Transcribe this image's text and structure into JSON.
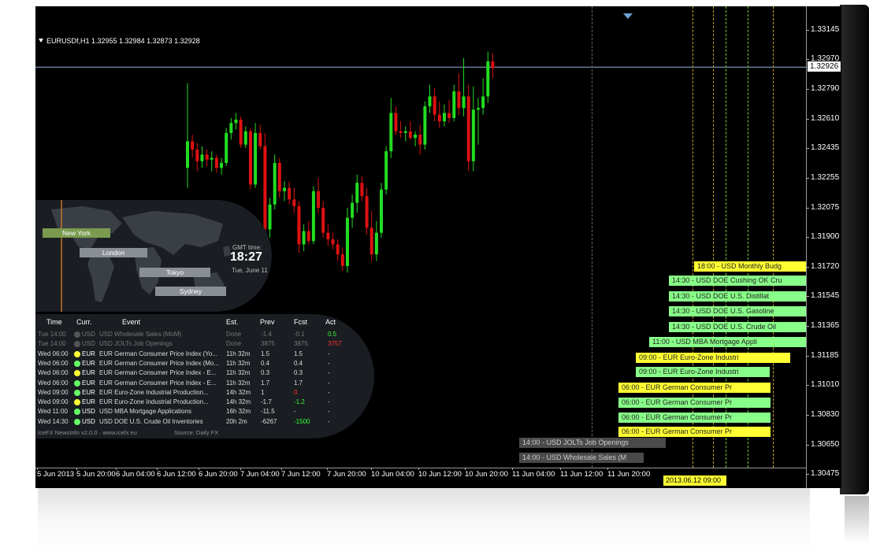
{
  "symbol_header": "EURUSDf,H1  1.32955 1.32984 1.32873 1.32928",
  "current_price": "1.32926",
  "price_axis": [
    "1.33145",
    "1.32970",
    "1.32790",
    "1.32610",
    "1.32435",
    "1.32255",
    "1.32075",
    "1.31900",
    "1.31720",
    "1.31545",
    "1.31365",
    "1.31185",
    "1.31010",
    "1.30830",
    "1.30650",
    "1.30475"
  ],
  "time_axis": [
    "5 Jun 2013",
    "5 Jun 20:00",
    "6 Jun 04:00",
    "6 Jun 12:00",
    "6 Jun 20:00",
    "7 Jun 04:00",
    "7 Jun 12:00",
    "7 Jun 20:00",
    "10 Jun 04:00",
    "10 Jun 12:00",
    "10 Jun 20:00",
    "11 Jun 04:00",
    "11 Jun 12:00",
    "11 Jun 20:00"
  ],
  "current_time_badge": "2013.06.12 09:00",
  "colors": {
    "bull": "#22dd22",
    "bear": "#dd1111",
    "bid_line": "#8fb3d9",
    "news_yellow": "#ffff33",
    "news_green": "#88ff88",
    "news_gray": "#4a4a4a"
  },
  "candles": [
    [
      1.3232,
      1.3283,
      1.322,
      1.3248
    ],
    [
      1.3248,
      1.3252,
      1.3238,
      1.3243
    ],
    [
      1.3243,
      1.3247,
      1.323,
      1.3236
    ],
    [
      1.3236,
      1.3245,
      1.3232,
      1.324
    ],
    [
      1.324,
      1.3243,
      1.3233,
      1.3237
    ],
    [
      1.3237,
      1.3242,
      1.323,
      1.3238
    ],
    [
      1.3238,
      1.324,
      1.3229,
      1.3232
    ],
    [
      1.3232,
      1.3238,
      1.3228,
      1.3235
    ],
    [
      1.3235,
      1.3256,
      1.3233,
      1.3253
    ],
    [
      1.3253,
      1.3262,
      1.3249,
      1.3259
    ],
    [
      1.3259,
      1.3265,
      1.3255,
      1.3261
    ],
    [
      1.3261,
      1.3263,
      1.3244,
      1.3246
    ],
    [
      1.3246,
      1.3257,
      1.3244,
      1.3254
    ],
    [
      1.3254,
      1.3256,
      1.3219,
      1.3222
    ],
    [
      1.3222,
      1.3259,
      1.322,
      1.3253
    ],
    [
      1.3253,
      1.3258,
      1.3243,
      1.3245
    ],
    [
      1.3245,
      1.3253,
      1.3185,
      1.3195
    ],
    [
      1.3195,
      1.3214,
      1.319,
      1.321
    ],
    [
      1.321,
      1.324,
      1.3207,
      1.3235
    ],
    [
      1.3235,
      1.3238,
      1.3214,
      1.3218
    ],
    [
      1.3218,
      1.3224,
      1.3212,
      1.322
    ],
    [
      1.322,
      1.3224,
      1.321,
      1.3213
    ],
    [
      1.3213,
      1.322,
      1.3205,
      1.3209
    ],
    [
      1.3209,
      1.3212,
      1.3181,
      1.3186
    ],
    [
      1.3186,
      1.3198,
      1.3182,
      1.3194
    ],
    [
      1.3194,
      1.32,
      1.3186,
      1.3188
    ],
    [
      1.3188,
      1.3221,
      1.3186,
      1.3218
    ],
    [
      1.3218,
      1.3226,
      1.3205,
      1.3208
    ],
    [
      1.3208,
      1.3212,
      1.319,
      1.3193
    ],
    [
      1.3193,
      1.3198,
      1.3185,
      1.3189
    ],
    [
      1.3189,
      1.3193,
      1.3183,
      1.3186
    ],
    [
      1.3186,
      1.3189,
      1.3176,
      1.318
    ],
    [
      1.318,
      1.3184,
      1.317,
      1.3173
    ],
    [
      1.3173,
      1.3208,
      1.3169,
      1.3202
    ],
    [
      1.3202,
      1.3216,
      1.3196,
      1.3211
    ],
    [
      1.3211,
      1.3228,
      1.3205,
      1.3223
    ],
    [
      1.3223,
      1.3227,
      1.3212,
      1.3215
    ],
    [
      1.3215,
      1.322,
      1.3192,
      1.3196
    ],
    [
      1.3196,
      1.3206,
      1.3176,
      1.318
    ],
    [
      1.318,
      1.32,
      1.3176,
      1.3193
    ],
    [
      1.3193,
      1.3223,
      1.319,
      1.3219
    ],
    [
      1.3219,
      1.3245,
      1.3216,
      1.3242
    ],
    [
      1.3242,
      1.3274,
      1.3238,
      1.3265
    ],
    [
      1.3265,
      1.3269,
      1.3252,
      1.3254
    ],
    [
      1.3254,
      1.326,
      1.325,
      1.3253
    ],
    [
      1.3253,
      1.3257,
      1.3248,
      1.3254
    ],
    [
      1.3254,
      1.326,
      1.3249,
      1.325
    ],
    [
      1.325,
      1.3254,
      1.3245,
      1.3252
    ],
    [
      1.3252,
      1.3258,
      1.324,
      1.3246
    ],
    [
      1.3246,
      1.3272,
      1.3243,
      1.3269
    ],
    [
      1.3269,
      1.3282,
      1.3265,
      1.3275
    ],
    [
      1.3275,
      1.328,
      1.326,
      1.3264
    ],
    [
      1.3264,
      1.3272,
      1.3256,
      1.326
    ],
    [
      1.326,
      1.327,
      1.3257,
      1.3265
    ],
    [
      1.3265,
      1.3273,
      1.3259,
      1.3262
    ],
    [
      1.3262,
      1.3282,
      1.326,
      1.3278
    ],
    [
      1.3278,
      1.3289,
      1.3264,
      1.3268
    ],
    [
      1.3268,
      1.3298,
      1.3263,
      1.3275
    ],
    [
      1.3275,
      1.3282,
      1.323,
      1.3236
    ],
    [
      1.3236,
      1.3281,
      1.323,
      1.3267
    ],
    [
      1.3267,
      1.3274,
      1.3246,
      1.3268
    ],
    [
      1.3268,
      1.3286,
      1.3264,
      1.3275
    ],
    [
      1.3275,
      1.3302,
      1.3271,
      1.3296
    ],
    [
      1.3296,
      1.3301,
      1.3286,
      1.3292
    ]
  ],
  "cities": [
    "New York",
    "London",
    "Tokyo",
    "Sydney"
  ],
  "gmt": {
    "label": "GMT time:",
    "time": "18:27",
    "date": "Tue, June 11"
  },
  "table_headers": [
    "Time",
    "Curr.",
    "Event",
    "Est.",
    "Prev",
    "Fcst",
    "Act"
  ],
  "rows": [
    {
      "time": "Tue 14:00",
      "dot": "#555555",
      "curr": "USD",
      "event": "USD Wholesale Sales (MoM)",
      "est": "Done",
      "prev": "-1.4",
      "fcst": "-0.1",
      "act": "0.5",
      "act_color": "#33ff33",
      "dim": true
    },
    {
      "time": "Tue 14:00",
      "dot": "#555555",
      "curr": "USD",
      "event": "USD JOLTs Job Openings",
      "est": "Done",
      "prev": "3875",
      "fcst": "3875",
      "act": "3757",
      "act_color": "#ff3333",
      "dim": true
    },
    {
      "time": "Wed 06:00",
      "dot": "#ffff33",
      "curr": "EUR",
      "event": "EUR German Consumer Price Index (Yo...",
      "est": "11h 32m",
      "prev": "1.5",
      "fcst": "1.5",
      "act": "-",
      "act_color": "#dddddd",
      "dim": false
    },
    {
      "time": "Wed 06:00",
      "dot": "#66ff66",
      "curr": "EUR",
      "event": "EUR German Consumer Price Index (Mo...",
      "est": "11h 32m",
      "prev": "0.4",
      "fcst": "0.4",
      "act": "-",
      "act_color": "#dddddd",
      "dim": false
    },
    {
      "time": "Wed 06:00",
      "dot": "#ffff33",
      "curr": "EUR",
      "event": "EUR German Consumer Price Index - E...",
      "est": "11h 32m",
      "prev": "0.3",
      "fcst": "0.3",
      "act": "-",
      "act_color": "#dddddd",
      "dim": false
    },
    {
      "time": "Wed 06:00",
      "dot": "#66ff66",
      "curr": "EUR",
      "event": "EUR German Consumer Price Index - E...",
      "est": "11h 32m",
      "prev": "1.7",
      "fcst": "1.7",
      "act": "-",
      "act_color": "#dddddd",
      "dim": false
    },
    {
      "time": "Wed 09:00",
      "dot": "#66ff66",
      "curr": "EUR",
      "event": "EUR Euro-Zone Industrial Production...",
      "est": "14h 32m",
      "prev": "1",
      "fcst": "0",
      "fcst_color": "#ff3333",
      "act": "-",
      "act_color": "#dddddd",
      "dim": false
    },
    {
      "time": "Wed 09:00",
      "dot": "#ffff33",
      "curr": "EUR",
      "event": "EUR Euro-Zone Industrial Production...",
      "est": "14h 32m",
      "prev": "-1.7",
      "fcst": "-1.2",
      "fcst_color": "#33ff33",
      "act": "-",
      "act_color": "#dddddd",
      "dim": false
    },
    {
      "time": "Wed 11:00",
      "dot": "#66ff66",
      "curr": "USD",
      "event": "USD MBA Mortgage Applications",
      "est": "16h 32m",
      "prev": "-11.5",
      "fcst": "-",
      "act": "-",
      "act_color": "#dddddd",
      "dim": false
    },
    {
      "time": "Wed 14:30",
      "dot": "#66ff66",
      "curr": "USD",
      "event": "USD DOE U.S. Crude Oil Inventories",
      "est": "20h 2m",
      "prev": "-6267",
      "fcst": "-1500",
      "fcst_color": "#33ff33",
      "act": "-",
      "act_color": "#dddddd",
      "dim": false
    }
  ],
  "footer": {
    "left": "IceFX NewsInfo v2.0.0  ·  www.icefx.eu",
    "right": "Source: Daily FX"
  },
  "news_badges": [
    {
      "text": "18:00 - USD Monthly Budg",
      "color": "yellow"
    },
    {
      "text": "14:30 - USD DOE Cushing OK Cru",
      "color": "green"
    },
    {
      "text": "14:30 - USD DOE U.S. Distillat",
      "color": "green"
    },
    {
      "text": "14:30 - USD DOE U.S. Gasoline",
      "color": "green"
    },
    {
      "text": "14:30 - USD DOE U.S. Crude Oil",
      "color": "green"
    },
    {
      "text": "11:00 - USD MBA Mortgage Appli",
      "color": "green"
    },
    {
      "text": "09:00 - EUR Euro-Zone Industri",
      "color": "yellow"
    },
    {
      "text": "09:00 - EUR Euro-Zone Industri",
      "color": "green"
    },
    {
      "text": "06:00 - EUR German Consumer Pr",
      "color": "yellow"
    },
    {
      "text": "06:00 - EUR German Consumer Pr",
      "color": "green"
    },
    {
      "text": "06:00 - EUR German Consumer Pr",
      "color": "green"
    },
    {
      "text": "06:00 - EUR German Consumer Pr",
      "color": "yellow"
    }
  ],
  "past_badges": [
    {
      "text": "14:00 - USD JOLTs Job Openings"
    },
    {
      "text": "14:00 - USD Wholesale Sales (M"
    }
  ]
}
